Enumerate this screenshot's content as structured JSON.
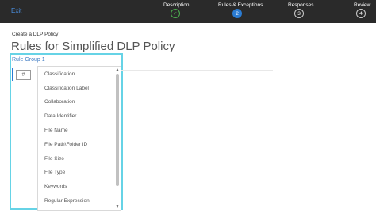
{
  "header": {
    "exit_label": "Exit",
    "steps": [
      {
        "label": "Description",
        "number": "✓",
        "state": "done"
      },
      {
        "label": "Rules & Exceptions",
        "number": "2",
        "state": "active"
      },
      {
        "label": "Responses",
        "number": "3",
        "state": "todo"
      },
      {
        "label": "Review",
        "number": "4",
        "state": "todo"
      }
    ]
  },
  "breadcrumb": "Create a DLP Policy",
  "page_title": "Rules for Simplified DLP Policy",
  "rule_group_label": "Rule Group 1",
  "condition_field_symbol": "#",
  "dropdown": {
    "items": [
      "Classification",
      "Classification Label",
      "Collaboration",
      "Data Identifier",
      "File Name",
      "File Path\\Folder ID",
      "File Size",
      "File Type",
      "Keywords",
      "Regular Expression"
    ]
  },
  "colors": {
    "topbar": "#2a2a2a",
    "accent": "#2b7cd3",
    "done": "#4caf50",
    "highlight": "#66d3e6"
  }
}
